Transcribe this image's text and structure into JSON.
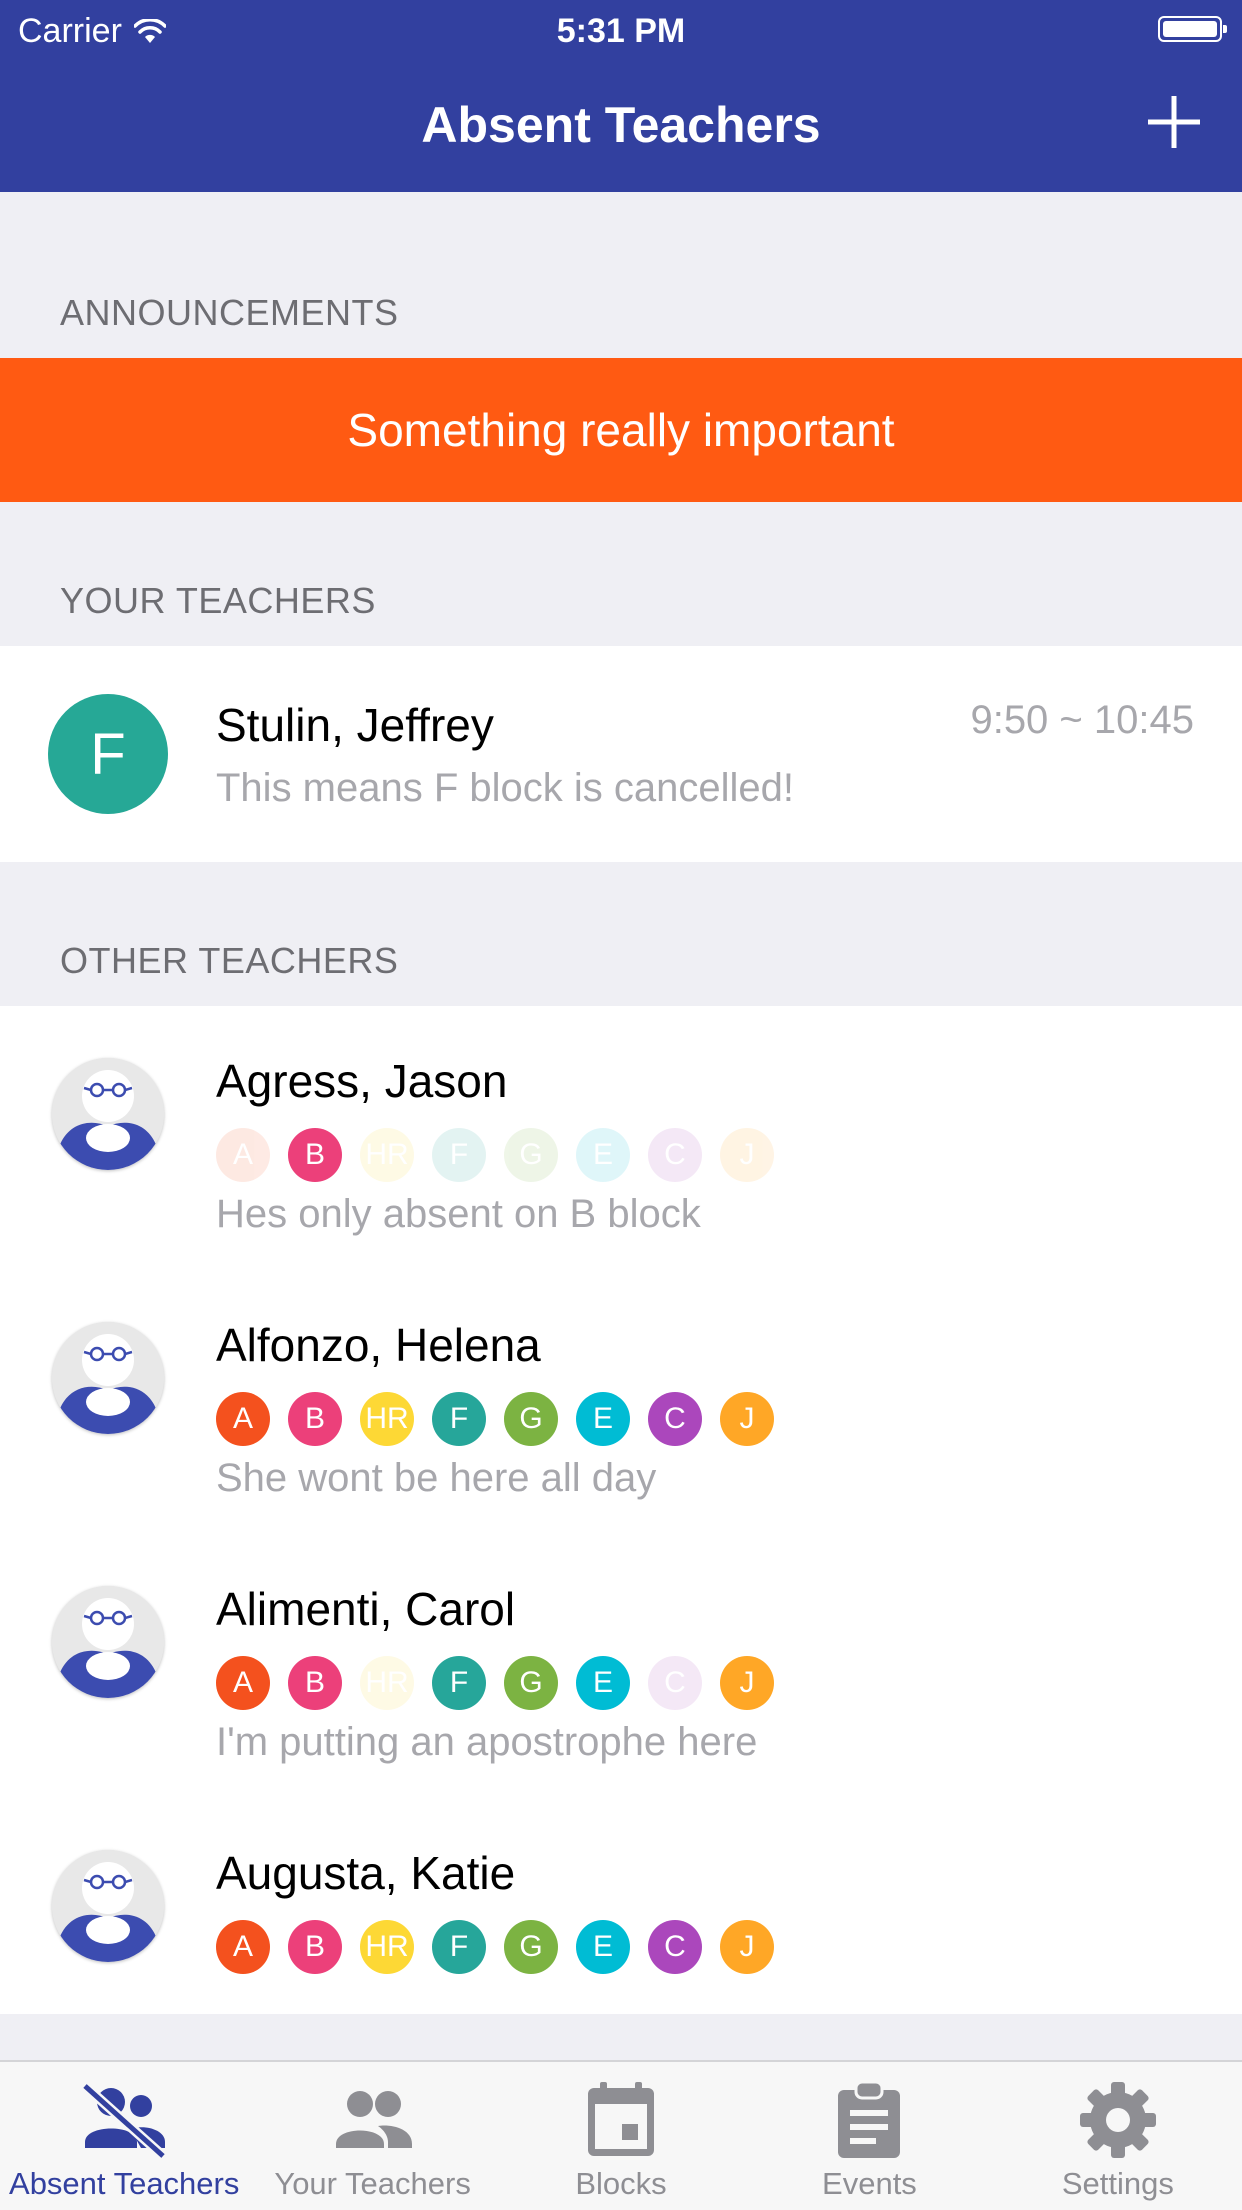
{
  "status": {
    "carrier": "Carrier",
    "time": "5:31 PM"
  },
  "nav": {
    "title": "Absent Teachers",
    "add_icon": "plus-icon"
  },
  "sections": {
    "announcements": "ANNOUNCEMENTS",
    "your_teachers": "YOUR TEACHERS",
    "other_teachers": "OTHER TEACHERS"
  },
  "announcement": {
    "text": "Something really important",
    "color": "#ff5a12"
  },
  "your_teacher": {
    "block": "F",
    "name": "Stulin, Jeffrey",
    "time": "9:50 ~ 10:45",
    "note": "This means F block is cancelled!",
    "color": "#26a896"
  },
  "block_colors": {
    "A": "#f4511e",
    "B": "#ec407a",
    "HR": "#fdd835",
    "F": "#26a69a",
    "G": "#7cb342",
    "E": "#00bcd4",
    "C": "#ab47bc",
    "J": "#ffa726"
  },
  "other_teachers": [
    {
      "name": "Agress, Jason",
      "note": "Hes only absent on B block",
      "blocks": [
        {
          "label": "A",
          "absent": false
        },
        {
          "label": "B",
          "absent": true
        },
        {
          "label": "HR",
          "absent": false
        },
        {
          "label": "F",
          "absent": false
        },
        {
          "label": "G",
          "absent": false
        },
        {
          "label": "E",
          "absent": false
        },
        {
          "label": "C",
          "absent": false
        },
        {
          "label": "J",
          "absent": false
        }
      ]
    },
    {
      "name": "Alfonzo, Helena",
      "note": "She wont be here all day",
      "blocks": [
        {
          "label": "A",
          "absent": true
        },
        {
          "label": "B",
          "absent": true
        },
        {
          "label": "HR",
          "absent": true
        },
        {
          "label": "F",
          "absent": true
        },
        {
          "label": "G",
          "absent": true
        },
        {
          "label": "E",
          "absent": true
        },
        {
          "label": "C",
          "absent": true
        },
        {
          "label": "J",
          "absent": true
        }
      ]
    },
    {
      "name": "Alimenti, Carol",
      "note": "I'm putting an apostrophe here",
      "blocks": [
        {
          "label": "A",
          "absent": true
        },
        {
          "label": "B",
          "absent": true
        },
        {
          "label": "HR",
          "absent": false
        },
        {
          "label": "F",
          "absent": true
        },
        {
          "label": "G",
          "absent": true
        },
        {
          "label": "E",
          "absent": true
        },
        {
          "label": "C",
          "absent": false
        },
        {
          "label": "J",
          "absent": true
        }
      ]
    },
    {
      "name": "Augusta, Katie",
      "note": "",
      "blocks": [
        {
          "label": "A",
          "absent": true
        },
        {
          "label": "B",
          "absent": true
        },
        {
          "label": "HR",
          "absent": true
        },
        {
          "label": "F",
          "absent": true
        },
        {
          "label": "G",
          "absent": true
        },
        {
          "label": "E",
          "absent": true
        },
        {
          "label": "C",
          "absent": true
        },
        {
          "label": "J",
          "absent": true
        }
      ]
    }
  ],
  "tabs": [
    {
      "label": "Absent Teachers",
      "icon": "absent-teachers-icon",
      "active": true
    },
    {
      "label": "Your Teachers",
      "icon": "people-icon",
      "active": false
    },
    {
      "label": "Blocks",
      "icon": "calendar-icon",
      "active": false
    },
    {
      "label": "Events",
      "icon": "clipboard-icon",
      "active": false
    },
    {
      "label": "Settings",
      "icon": "gear-icon",
      "active": false
    }
  ],
  "colors": {
    "nav": "#32409f",
    "active_tab": "#32409f",
    "inactive_tab": "#8e8e93"
  }
}
